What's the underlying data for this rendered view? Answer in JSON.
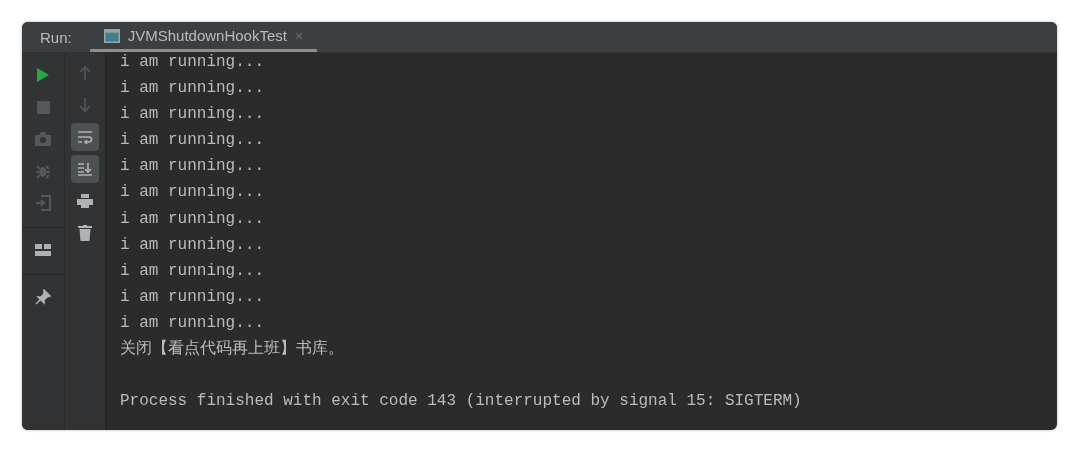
{
  "header": {
    "label": "Run:",
    "tabs": [
      {
        "label": "JVMShutdownHookTest",
        "selected": true,
        "close": "×"
      }
    ]
  },
  "left_toolbar": [
    [
      {
        "kind": "run",
        "disabled": false
      },
      {
        "kind": "stop",
        "disabled": true
      },
      {
        "kind": "camera",
        "disabled": true
      },
      {
        "kind": "bug",
        "disabled": true
      },
      {
        "kind": "exit",
        "disabled": true
      }
    ],
    [
      {
        "kind": "layout",
        "disabled": false
      }
    ],
    [
      {
        "kind": "pin",
        "disabled": false
      }
    ]
  ],
  "right_toolbar": [
    {
      "kind": "up",
      "disabled": true,
      "on": false
    },
    {
      "kind": "down",
      "disabled": true,
      "on": false
    },
    {
      "kind": "wrap",
      "disabled": false,
      "on": true
    },
    {
      "kind": "scroll-end",
      "disabled": false,
      "on": true
    },
    {
      "kind": "print",
      "disabled": false,
      "on": false
    },
    {
      "kind": "trash",
      "disabled": false,
      "on": false
    }
  ],
  "console": [
    {
      "kind": "output",
      "text": "i am running..."
    },
    {
      "kind": "output",
      "text": "i am running..."
    },
    {
      "kind": "output",
      "text": "i am running..."
    },
    {
      "kind": "output",
      "text": "i am running..."
    },
    {
      "kind": "output",
      "text": "i am running..."
    },
    {
      "kind": "output",
      "text": "i am running..."
    },
    {
      "kind": "output",
      "text": "i am running..."
    },
    {
      "kind": "output",
      "text": "i am running..."
    },
    {
      "kind": "output",
      "text": "i am running..."
    },
    {
      "kind": "output",
      "text": "i am running..."
    },
    {
      "kind": "output",
      "text": "i am running..."
    },
    {
      "kind": "output",
      "text": "关闭【看点代码再上班】书库。"
    },
    {
      "kind": "blank"
    },
    {
      "kind": "status",
      "text": "Process finished with exit code 143 (interrupted by signal 15: SIGTERM)"
    }
  ]
}
